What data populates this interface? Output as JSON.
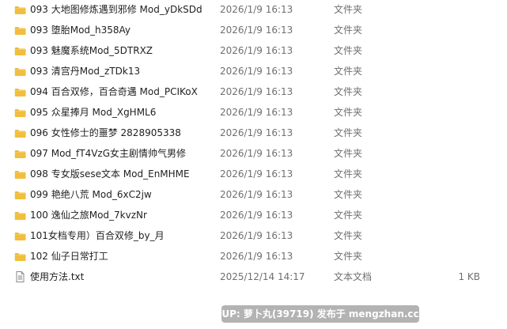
{
  "files": [
    {
      "icon": "folder-icon",
      "name": "093 大地图修炼遇到邪修 Mod_yDkSDd",
      "date": "2026/1/9 16:13",
      "type": "文件夹",
      "size": ""
    },
    {
      "icon": "folder-icon",
      "name": "093 堕胎Mod_h358Ay",
      "date": "2026/1/9 16:13",
      "type": "文件夹",
      "size": ""
    },
    {
      "icon": "folder-icon",
      "name": "093 魅魔系统Mod_5DTRXZ",
      "date": "2026/1/9 16:13",
      "type": "文件夹",
      "size": ""
    },
    {
      "icon": "folder-icon",
      "name": "093 清宫丹Mod_zTDk13",
      "date": "2026/1/9 16:13",
      "type": "文件夹",
      "size": ""
    },
    {
      "icon": "folder-icon",
      "name": "094 百合双修，百合奇遇 Mod_PCIKoX",
      "date": "2026/1/9 16:13",
      "type": "文件夹",
      "size": ""
    },
    {
      "icon": "folder-icon",
      "name": "095 众星捧月 Mod_XgHML6",
      "date": "2026/1/9 16:13",
      "type": "文件夹",
      "size": ""
    },
    {
      "icon": "folder-icon",
      "name": "096 女性修士的噩梦 2828905338",
      "date": "2026/1/9 16:13",
      "type": "文件夹",
      "size": ""
    },
    {
      "icon": "folder-icon",
      "name": "097 Mod_fT4VzG女主剧情帅气男修",
      "date": "2026/1/9 16:13",
      "type": "文件夹",
      "size": ""
    },
    {
      "icon": "folder-icon",
      "name": "098 专女版sese文本 Mod_EnMHME",
      "date": "2026/1/9 16:13",
      "type": "文件夹",
      "size": ""
    },
    {
      "icon": "folder-icon",
      "name": "099 艳绝八荒 Mod_6xC2jw",
      "date": "2026/1/9 16:13",
      "type": "文件夹",
      "size": ""
    },
    {
      "icon": "folder-icon",
      "name": "100 逸仙之旅Mod_7kvzNr",
      "date": "2026/1/9 16:13",
      "type": "文件夹",
      "size": ""
    },
    {
      "icon": "folder-icon",
      "name": "101女档专用）百合双修_by_月",
      "date": "2026/1/9 16:13",
      "type": "文件夹",
      "size": ""
    },
    {
      "icon": "folder-icon",
      "name": "102 仙子日常打工",
      "date": "2026/1/9 16:13",
      "type": "文件夹",
      "size": ""
    },
    {
      "icon": "text-file-icon",
      "name": "使用方法.txt",
      "date": "2025/12/14 14:17",
      "type": "文本文档",
      "size": "1 KB"
    }
  ],
  "watermark": {
    "text": "UP: 萝卜丸(39719) 发布于 mengzhan.cc"
  },
  "colors": {
    "folder_body": "#f2be3b",
    "folder_tab": "#e0a823",
    "secondary_text": "#6f6f6f"
  }
}
